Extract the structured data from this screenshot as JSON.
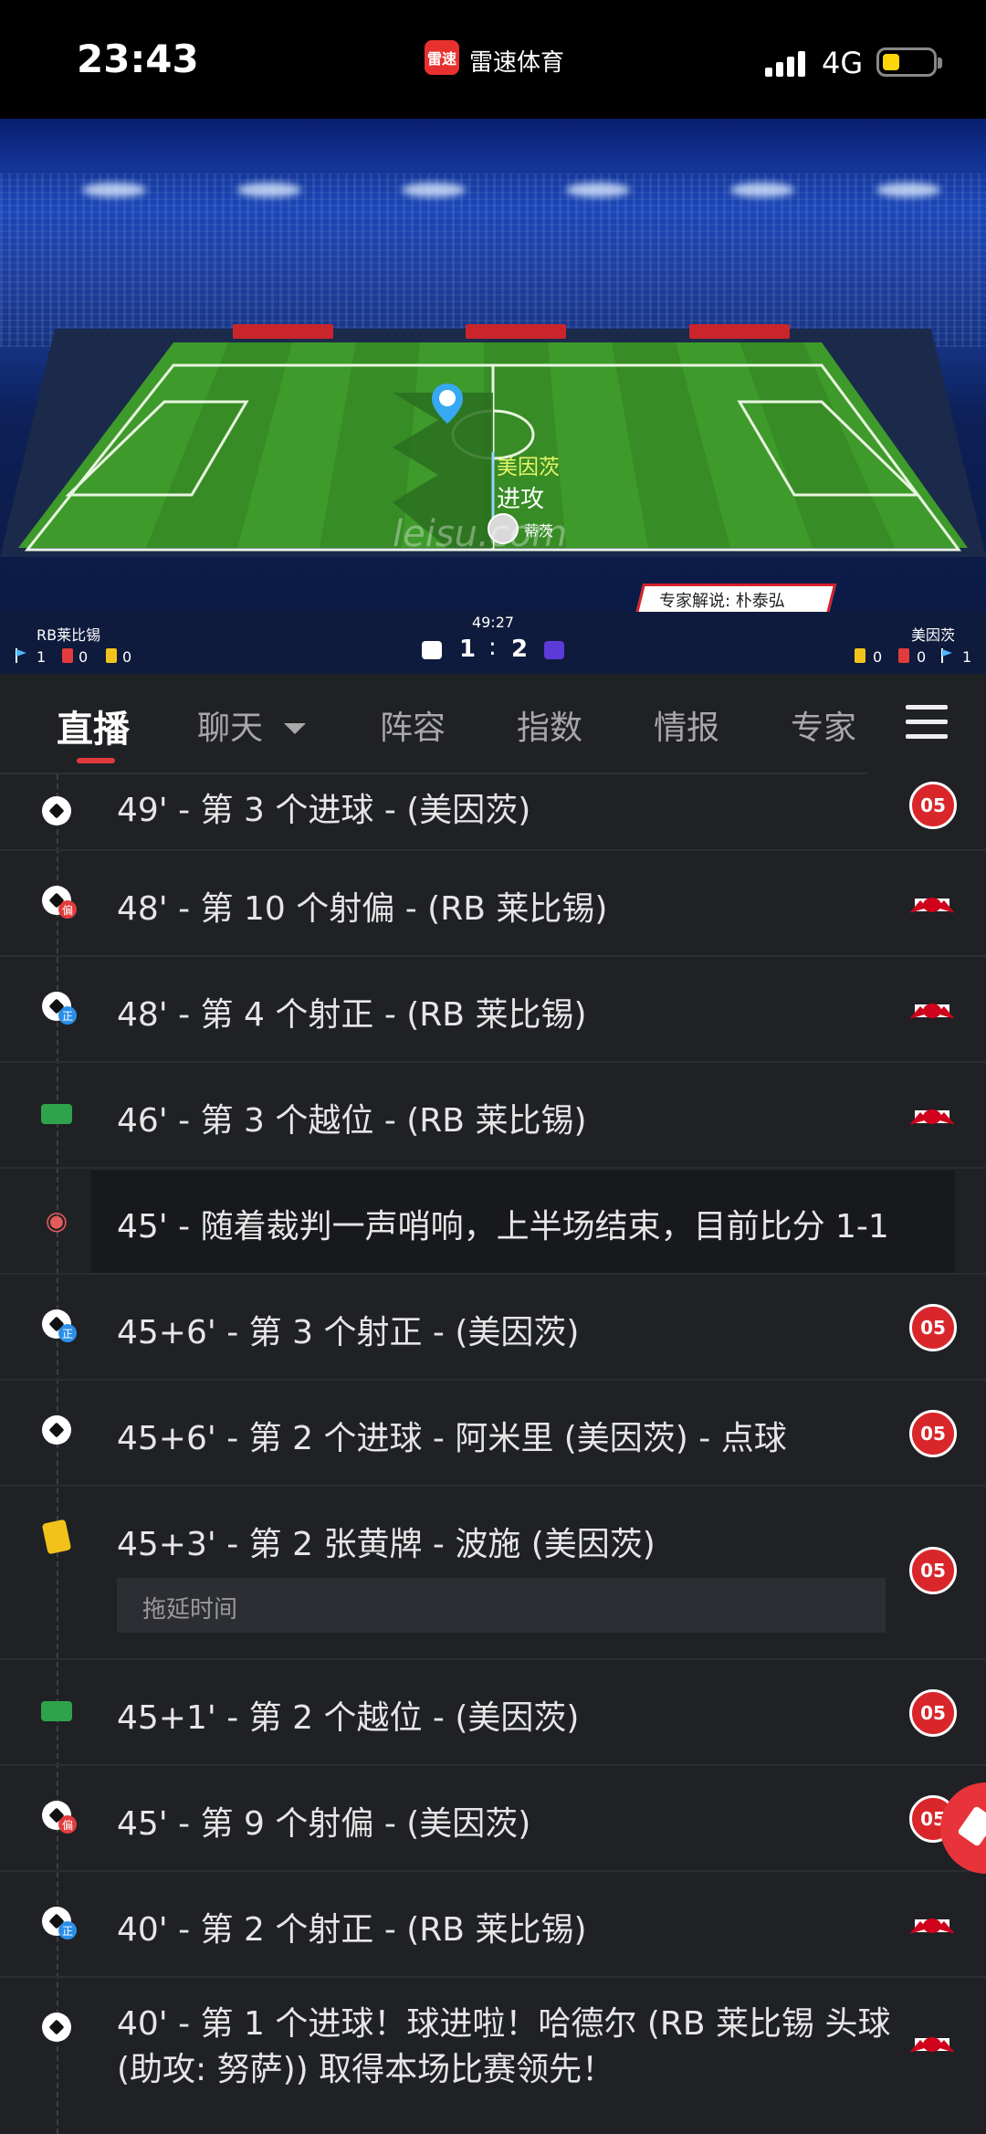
{
  "status_bar": {
    "time": "23:43",
    "app_badge": "雷速",
    "app_name": "雷速体育",
    "network": "4G"
  },
  "stadium": {
    "event_team": "美因茨",
    "event_action": "进攻",
    "event_player": "蒂茨",
    "watermark": "leisu.com",
    "expert_commentary": "专家解说: 朴泰弘"
  },
  "scoreboard": {
    "home_team": "RB莱比锡",
    "away_team": "美因茨",
    "clock": "49:27",
    "home_score": "1",
    "separator": ":",
    "away_score": "2",
    "home_corners": "1",
    "home_red": "0",
    "home_yellow": "0",
    "away_yellow": "0",
    "away_red": "0",
    "away_corners": "1"
  },
  "tabs": [
    "直播",
    "聊天",
    "阵容",
    "指数",
    "情报",
    "专家"
  ],
  "feed": [
    {
      "text": "49' - 第 3 个进球 - (美因茨)",
      "icon": "goal-icon",
      "team": "mainz"
    },
    {
      "text": "48' - 第 10 个射偏 - (RB 莱比锡)",
      "icon": "shot-off-target-icon",
      "team": "rb",
      "sub": "偏"
    },
    {
      "text": "48' - 第 4 个射正 - (RB 莱比锡)",
      "icon": "shot-on-target-icon",
      "team": "rb",
      "sub": "正"
    },
    {
      "text": "46' - 第 3 个越位 - (RB 莱比锡)",
      "icon": "offside-icon",
      "team": "rb"
    },
    {
      "text": "45' - 随着裁判一声哨响，上半场结束，目前比分 1-1",
      "icon": "whistle-icon",
      "team": ""
    },
    {
      "text": "45+6' - 第 3 个射正 - (美因茨)",
      "icon": "shot-on-target-icon",
      "team": "mainz",
      "sub": "正"
    },
    {
      "text": "45+6' - 第 2 个进球 - 阿米里 (美因茨) - 点球",
      "icon": "goal-icon",
      "team": "mainz"
    },
    {
      "text": "45+3' - 第 2 张黄牌 - 波施 (美因茨)",
      "icon": "yellow-card-icon",
      "team": "mainz",
      "note": "拖延时间"
    },
    {
      "text": "45+1' - 第 2 个越位 - (美因茨)",
      "icon": "offside-icon",
      "team": "mainz"
    },
    {
      "text": "45' - 第 9 个射偏 - (美因茨)",
      "icon": "shot-off-target-icon",
      "team": "mainz",
      "sub": "偏"
    },
    {
      "text": "40' - 第 2 个射正 - (RB 莱比锡)",
      "icon": "shot-on-target-icon",
      "team": "rb",
      "sub": "正"
    },
    {
      "text": "40' - 第 1 个进球！球进啦！哈德尔 (RB 莱比锡 头球 (助攻: 努萨)) 取得本场比赛领先！",
      "icon": "goal-icon",
      "team": "rb"
    }
  ],
  "colors": {
    "accent": "#e03a3e",
    "mainz": "#d9262b",
    "rb_red": "#d0021b"
  }
}
